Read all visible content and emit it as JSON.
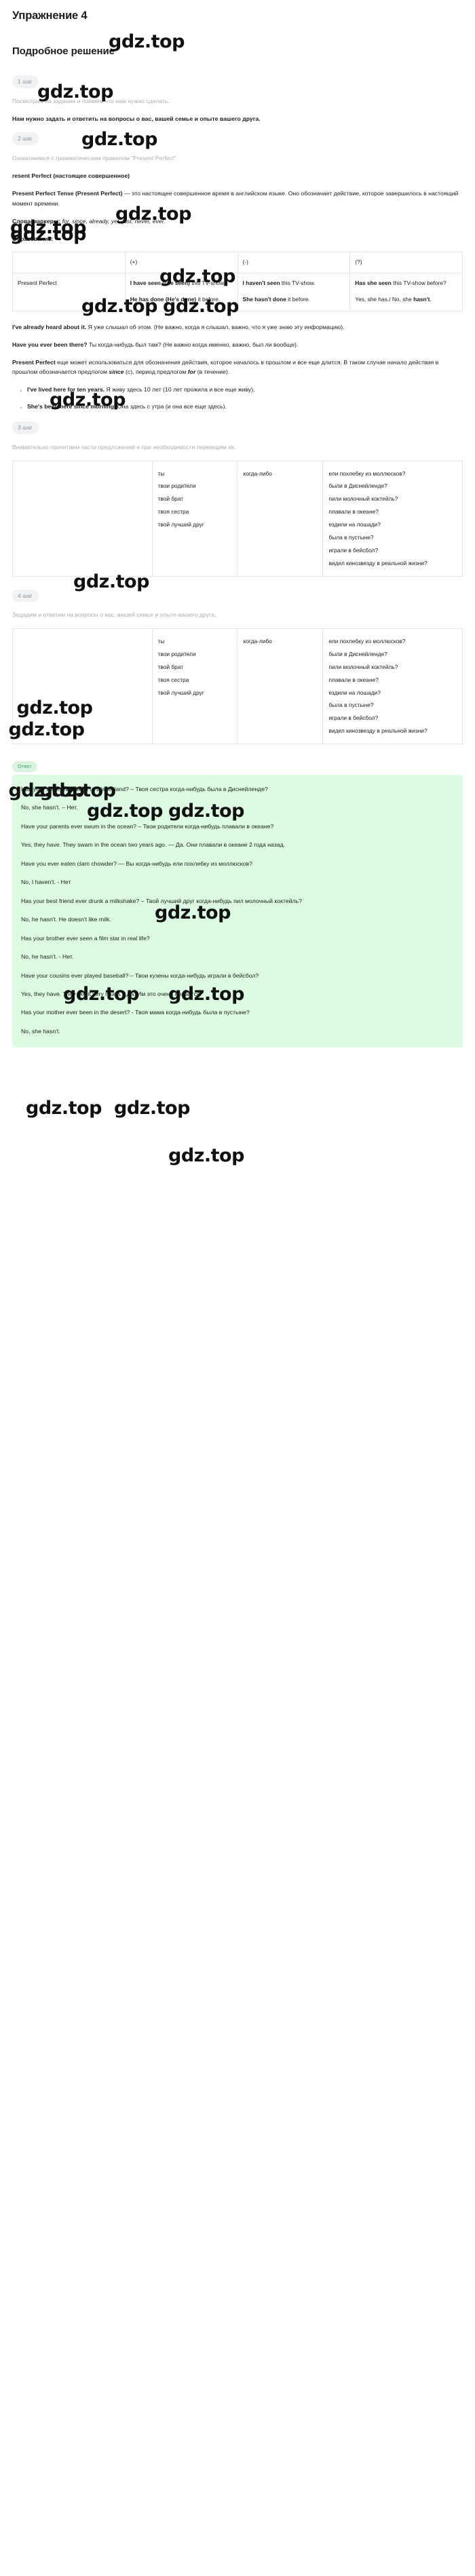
{
  "exercise": {
    "title": "Упражнение 4",
    "solution_heading": "Подробное решение"
  },
  "watermark": {
    "text": "gdz.top"
  },
  "steps": [
    {
      "badge": "1 шаг",
      "intro": "Посмотрим на задание и поймём что нам нужно сделать.",
      "task": "Нам нужно задать и ответить на вопросы о вас, вашей семье и опыте вашего друга."
    },
    {
      "badge": "2 шаг",
      "intro": "Ознакомимся с грамматическим правилом \"Present Perfect\".",
      "rule_title": "resent Perfect (настоящее совершенное)",
      "rule_p1": "Present Perfect Tense (Present Perfect) — это настоящее совершенное время в английском языке. Оно обозначает действие, которое завершилось в настоящий момент времени.",
      "markers_label": "Слова-маркеры:",
      "markers_value": "for, since, already, yet, just, never, ever.",
      "formation_label": "Образование:",
      "q1": "I've already heard about it.",
      "q1_tr": "Я уже слышал об этом. (Не важно, когда я слышал, важно, что я уже знаю эту информацию).",
      "q2": "Have you ever been there?",
      "q2_tr": "Ты когда-нибудь был там? (Не важно когда именно, важно, был ли вообще).",
      "p_long": "Present Perfect еще может использоваться для обозначения действия, которое началось в прошлом и все еще длится. В таком случае начало действия в прошлом обозначается предлогом since (с), период предлогом for (в течение).",
      "bullets": [
        {
          "en": "I've lived here for ten years.",
          "ru": "Я живу здесь 10 лет (10 лет прожила и все еще живу)."
        },
        {
          "en": "She's been here since morning.",
          "ru": "Она здесь с утра (и она все еще здесь)."
        }
      ]
    },
    {
      "badge": "3 шаг",
      "intro": "Внимательно прочитаем части предложений и при необходимости переведём их."
    },
    {
      "badge": "4 шаг",
      "intro": "Зададим и ответим на вопросы о вас, вашей семье и опыте вашего друга."
    }
  ],
  "grammar_table": {
    "corner": "",
    "headers": [
      "(+)",
      "(-)",
      "(?)"
    ],
    "row_label": "Present Perfect",
    "cells": {
      "plus": [
        {
          "bold1": "I have seen (I've seen)",
          "rest1": " this TV-show."
        },
        {
          "bold1": "He has done (He's done)",
          "rest1": " it before."
        }
      ],
      "minus": [
        {
          "bold1": "I haven't seen",
          "rest1": " this TV-show."
        },
        {
          "bold1": "She hasn't done",
          "rest1": " it before."
        }
      ],
      "question": [
        {
          "bold1": "Has she seen",
          "rest1": " this TV-show before?"
        },
        {
          "rest1": "Yes, she has./ No, she ",
          "bold1": "hasn't",
          "tail": "."
        }
      ]
    }
  },
  "match_table": {
    "col1": [
      "ты",
      "твои родители",
      "твой брат",
      "твоя сестра",
      "твой лучший друг"
    ],
    "col2": [
      "когда-либо"
    ],
    "col3": [],
    "col4": [
      "ели похлебку из моллюсков?",
      "были в Диснейленде?",
      "пили молочный коктейль?",
      "плавали в океане?",
      "ездили на лошади?",
      "была в пустыне?",
      "играли в бейсбол?",
      "видел кинозвезду в реальной жизни?"
    ]
  },
  "answer": {
    "label": "Ответ",
    "lines": [
      "Has your sister ever been to Disneyland? – Твоя сестра когда-нибудь была в Диснейленде?",
      "No, she hasn't. – Нет.",
      "Have your parents ever swum in the ocean? – Твои родители когда-нибудь плавали в океане?",
      "Yes, they have. They swam in the ocean two years ago. — Да. Они плавали в океане 2 года назад.",
      "Have you ever eaten clam chowder? — Вы когда-нибудь ели похлебку из моллюсков?",
      "No, I haven't. - Нет",
      "Has your best friend ever drunk a milkshake? – Твой лучший друг когда-нибудь пил молочный коктейль?",
      "No, he hasn't. He doesn't like milk.",
      "Has your brother ever seen a film star in real life?",
      "No, he hasn't. - Нет.",
      "Have your cousins ever played baseball? – Твои кузены когда-нибудь играли в бейсбол?",
      "Yes, they have. They like it very much. - Да. Им это очень нравится.",
      "Has your mother ever been in the desert? - Твоя мама когда-нибудь была в пустыне?",
      "No, she hasn't."
    ]
  }
}
